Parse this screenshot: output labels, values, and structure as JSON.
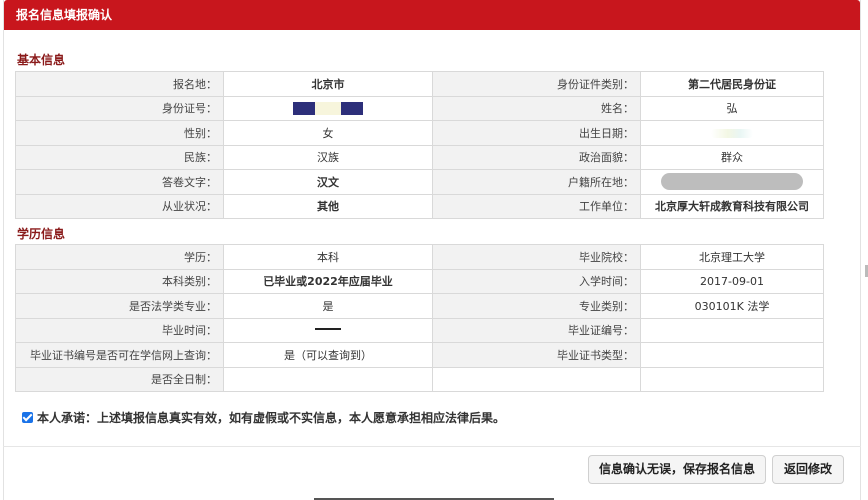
{
  "dialog": {
    "title": "报名信息填报确认"
  },
  "basic": {
    "heading": "基本信息",
    "rows": [
      {
        "l1": "报名地：",
        "v1": "北京市",
        "l2": "身份证件类别：",
        "v2": "第二代居民身份证"
      },
      {
        "l1": "身份证号：",
        "v1": "",
        "l2": "姓名：",
        "v2": "弘"
      },
      {
        "l1": "性别：",
        "v1": "女",
        "l2": "出生日期：",
        "v2": ""
      },
      {
        "l1": "民族：",
        "v1": "汉族",
        "l2": "政治面貌：",
        "v2": "群众"
      },
      {
        "l1": "答卷文字：",
        "v1": "汉文",
        "l2": "户籍所在地：",
        "v2": ""
      },
      {
        "l1": "从业状况：",
        "v1": "其他",
        "l2": "工作单位：",
        "v2": "北京厚大轩成教育科技有限公司"
      }
    ]
  },
  "education": {
    "heading": "学历信息",
    "rows": [
      {
        "l1": "学历：",
        "v1": "本科",
        "l2": "毕业院校：",
        "v2": "北京理工大学"
      },
      {
        "l1": "本科类别：",
        "v1": "已毕业或2022年应届毕业",
        "l2": "入学时间：",
        "v2": "2017-09-01"
      },
      {
        "l1": "是否法学类专业：",
        "v1": "是",
        "l2": "专业类别：",
        "v2": "030101K 法学"
      },
      {
        "l1": "毕业时间：",
        "v1": "",
        "l2": "毕业证编号：",
        "v2": ""
      },
      {
        "l1": "毕业证书编号是否可在学信网上查询：",
        "v1": "是（可以查询到）",
        "l2": "毕业证书类型：",
        "v2": ""
      },
      {
        "l1": "是否全日制：",
        "v1": "",
        "l2": "",
        "v2": ""
      }
    ]
  },
  "pledge": {
    "checked": true,
    "text": "本人承诺：上述填报信息真实有效，如有虚假或不实信息，本人愿意承担相应法律后果。"
  },
  "buttons": {
    "confirm": "信息确认无误，保存报名信息",
    "back": "返回修改"
  },
  "colors": {
    "title_bar": "#c8161d",
    "section_heading": "#8a1a1a",
    "checkbox": "#1a73e8"
  }
}
